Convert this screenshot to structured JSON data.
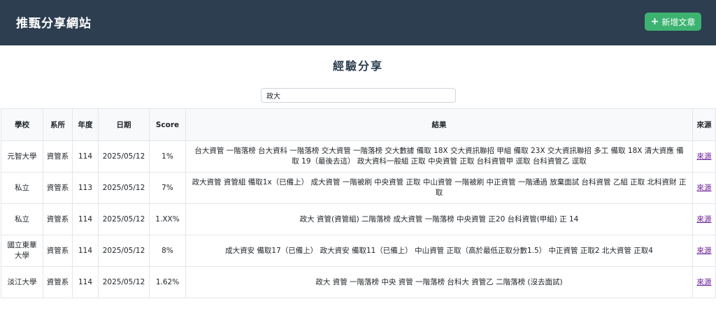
{
  "navbar": {
    "brand": "推甄分享網站",
    "add_button_icon": "plus-icon",
    "add_button_label": "新增文章"
  },
  "page": {
    "title": "經驗分享"
  },
  "search": {
    "value": "政大",
    "placeholder": ""
  },
  "table": {
    "headers": [
      "學校",
      "系所",
      "年度",
      "日期",
      "Score",
      "結果",
      "來源"
    ],
    "rows": [
      {
        "school": "元智大學",
        "dept": "資管系",
        "year": "114",
        "date": "2025/05/12",
        "score": "1%",
        "result": "台大資管 一階落榜 台大資科 一階落榜 交大資管 一階落榜 交大數據 備取 18X 交大資訊聯招 甲組 備取 23X 交大資訊聯招 多工 備取 18X 清大資應 備取 19（最後去這） 政大資科一般組 正取 中央資管 正取 台科資管甲 逕取 台科資管乙 逕取",
        "source": "來源"
      },
      {
        "school": "私立",
        "dept": "資管系",
        "year": "113",
        "date": "2025/05/12",
        "score": "7%",
        "result": "政大資管 資管組 備取1x（已備上） 成大資管 一階被刷 中央資管 正取 中山資管 一階被刷 中正資管 一階通過 放棄面試 台科資管 乙組 正取 北科資財 正取",
        "source": "來源"
      },
      {
        "school": "私立",
        "dept": "資管系",
        "year": "114",
        "date": "2025/05/12",
        "score": "1.XX%",
        "result": "政大 資管(資管組) 二階落榜 成大資管 一階落榜 中央資管 正20 台科資管(甲組) 正 14",
        "source": "來源"
      },
      {
        "school": "國立東華大學",
        "dept": "資管系",
        "year": "114",
        "date": "2025/05/12",
        "score": "8%",
        "result": "成大資安 備取17（已備上） 政大資安 備取11（已備上） 中山資管 正取（高於最低正取分數1.5） 中正資管 正取2 北大資管 正取4",
        "source": "來源"
      },
      {
        "school": "淡江大學",
        "dept": "資管系",
        "year": "114",
        "date": "2025/05/12",
        "score": "1.62%",
        "result": "政大 資管 一階落榜 中央 資管 一階落榜 台科大 資管乙 二階落榜 (沒去面試)",
        "source": "來源"
      }
    ]
  }
}
